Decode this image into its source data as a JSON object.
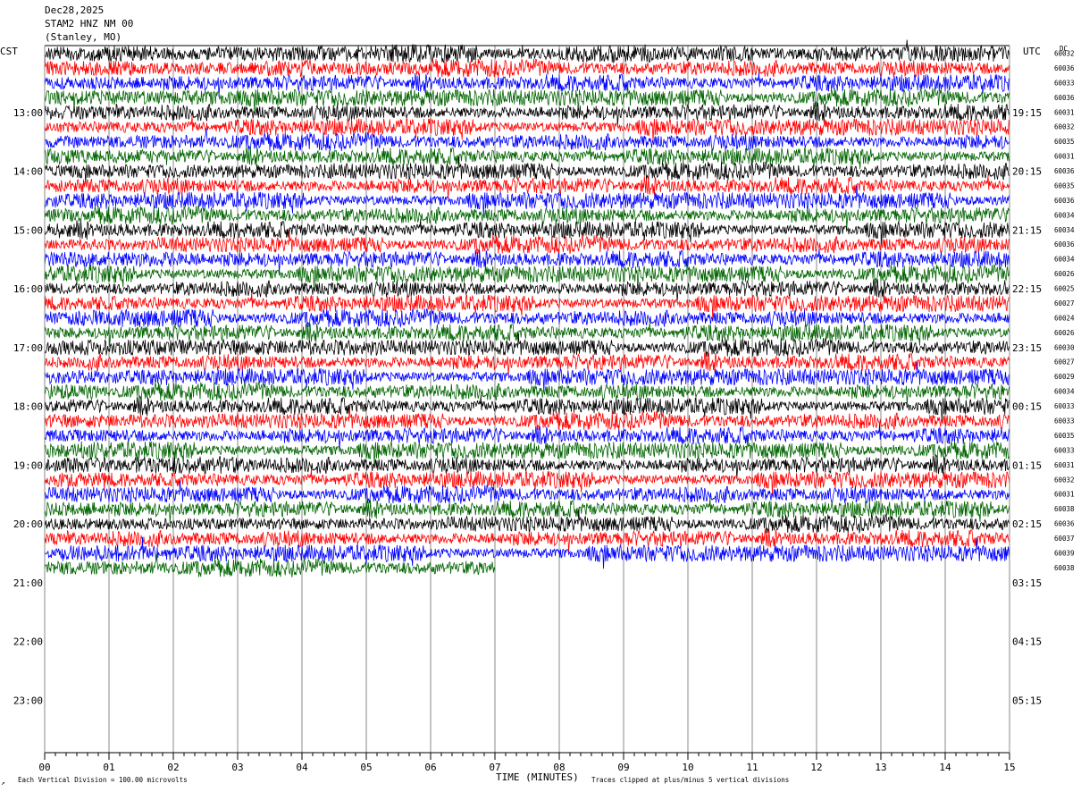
{
  "chart_data": {
    "type": "line",
    "title_lines": [
      "Dec28,2025",
      "STAM2 HNZ NM 00",
      "(Stanley, MO)"
    ],
    "left_timezone": "CST",
    "right_timezone": "UTC",
    "dc_header": "DC",
    "xlabel": "TIME (MINUTES)",
    "x_ticks": [
      "00",
      "01",
      "02",
      "03",
      "04",
      "05",
      "06",
      "07",
      "08",
      "09",
      "10",
      "11",
      "12",
      "13",
      "14",
      "15"
    ],
    "xlim": [
      0,
      15
    ],
    "left_hour_labels": [
      "13:00",
      "14:00",
      "15:00",
      "16:00",
      "17:00",
      "18:00",
      "19:00",
      "20:00",
      "21:00",
      "22:00",
      "23:00"
    ],
    "right_hour_labels": [
      "19:15",
      "20:15",
      "21:15",
      "22:15",
      "23:15",
      "00:15",
      "01:15",
      "02:15",
      "03:15",
      "04:15",
      "05:15"
    ],
    "trace_colors": [
      "#000000",
      "#ff0000",
      "#0000ff",
      "#006400"
    ],
    "traces_per_hour": 4,
    "trace_minutes": 15,
    "total_traces": 36,
    "last_trace_minutes": 7.0,
    "dc_offsets": [
      "60032",
      "60036",
      "60033",
      "60036",
      "60031",
      "60032",
      "60035",
      "60031",
      "60036",
      "60035",
      "60036",
      "60034",
      "60034",
      "60036",
      "60034",
      "60026",
      "60025",
      "60027",
      "60024",
      "60026",
      "60030",
      "60027",
      "60029",
      "60034",
      "60033",
      "60033",
      "60035",
      "60033",
      "60031",
      "60032",
      "60031",
      "60038",
      "60036",
      "60037",
      "60039",
      "60038"
    ],
    "footer_left": "Each Vertical Division =  100.00 microvolts",
    "footer_right": "Traces clipped at plus/minus 5 vertical divisions",
    "corner_mark": "↗"
  }
}
